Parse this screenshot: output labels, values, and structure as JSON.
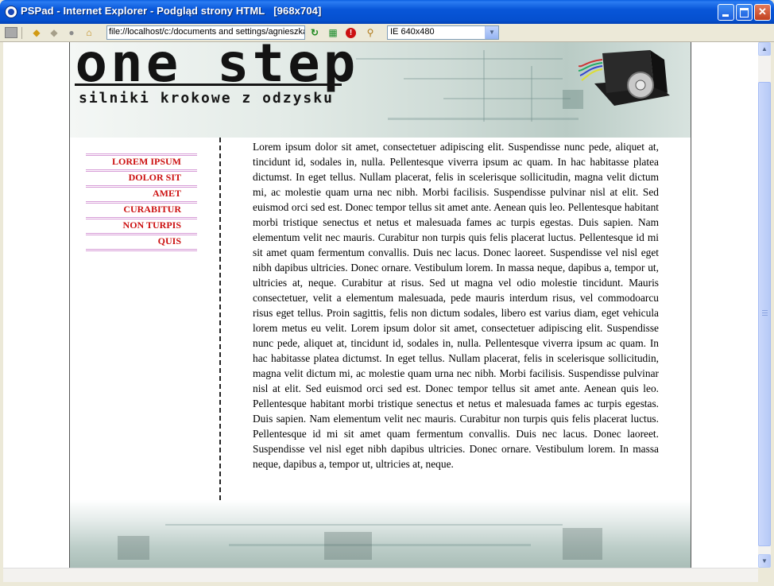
{
  "window": {
    "title": "PSPad - Internet Explorer - Podgląd strony HTML   [968x704]"
  },
  "toolbar": {
    "url": "file://localhost/c:/documents and settings/agnieszka/pulpit/onestep/index.html",
    "view_size": "IE 640x480"
  },
  "site": {
    "logo_text": "one step",
    "tagline": "silniki krokowe z odzysku",
    "nav": [
      "LOREM IPSUM",
      "DOLOR SIT",
      "AMET",
      "CURABITUR",
      "NON TURPIS",
      "QUIS"
    ],
    "body_text": "Lorem ipsum dolor sit amet, consectetuer adipiscing elit. Suspendisse nunc pede, aliquet at, tincidunt id, sodales in, nulla. Pellentesque viverra ipsum ac quam. In hac habitasse platea dictumst. In eget tellus. Nullam placerat, felis in scelerisque sollicitudin, magna velit dictum mi, ac molestie quam urna nec nibh. Morbi facilisis. Suspendisse pulvinar nisl at elit. Sed euismod orci sed est. Donec tempor tellus sit amet ante. Aenean quis leo. Pellentesque habitant morbi tristique senectus et netus et malesuada fames ac turpis egestas. Duis sapien. Nam elementum velit nec mauris. Curabitur non turpis quis felis placerat luctus. Pellentesque id mi sit amet quam fermentum convallis. Duis nec lacus. Donec laoreet. Suspendisse vel nisl eget nibh dapibus ultricies. Donec ornare. Vestibulum lorem. In massa neque, dapibus a, tempor ut, ultricies at, neque. Curabitur at risus. Sed ut magna vel odio molestie tincidunt. Mauris consectetuer, velit a elementum malesuada, pede mauris interdum risus, vel commodoarcu risus eget tellus. Proin sagittis, felis non dictum sodales, libero est varius diam, eget vehicula lorem metus eu velit. Lorem ipsum dolor sit amet, consectetuer adipiscing elit. Suspendisse nunc pede, aliquet at, tincidunt id, sodales in, nulla. Pellentesque viverra ipsum ac quam. In hac habitasse platea dictumst. In eget tellus. Nullam placerat, felis in scelerisque sollicitudin, magna velit dictum mi, ac molestie quam urna nec nibh. Morbi facilisis. Suspendisse pulvinar nisl at elit. Sed euismod orci sed est. Donec tempor tellus sit amet ante. Aenean quis leo. Pellentesque habitant morbi tristique senectus et netus et malesuada fames ac turpis egestas. Duis sapien. Nam elementum velit nec mauris. Curabitur non turpis quis felis placerat luctus. Pellentesque id mi sit amet quam fermentum convallis. Duis nec lacus. Donec laoreet. Suspendisse vel nisl eget nibh dapibus ultricies. Donec ornare. Vestibulum lorem. In massa neque, dapibus a, tempor ut, ultricies at, neque."
  },
  "colors": {
    "nav_text": "#cc1111",
    "nav_rule": "#d79dd7",
    "titlebar": "#0550cf"
  },
  "icons": [
    "ie-icon",
    "stop-icon",
    "back-icon",
    "forward-icon",
    "refresh-icon",
    "home-icon",
    "go-icon",
    "table-icon",
    "error-icon",
    "find-icon",
    "minimize-icon",
    "maximize-icon",
    "close-icon",
    "scroll-up-icon",
    "scroll-down-icon",
    "dropdown-arrow-icon"
  ]
}
